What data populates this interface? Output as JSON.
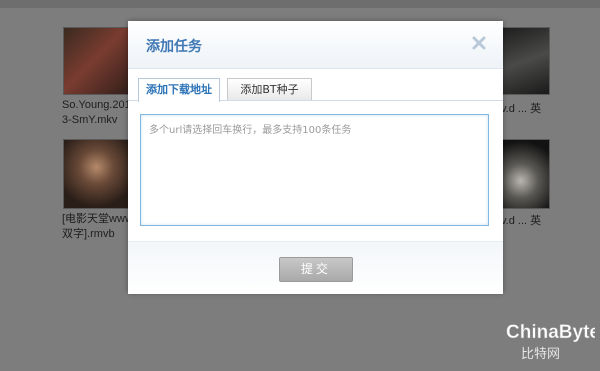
{
  "background_videos": [
    {
      "name_line1": "So.Young.201",
      "name_line2": "3-SmY.mkv"
    },
    {
      "name_line1": "[电影天堂www",
      "name_line2": "双字].rmvb"
    }
  ],
  "right_column_text": [
    "v.d ... 英",
    "v.d ... 英"
  ],
  "dialog": {
    "title": "添加任务",
    "tabs": [
      {
        "label": "添加下载地址",
        "active": true
      },
      {
        "label": "添加BT种子",
        "active": false
      }
    ],
    "textarea_placeholder": "多个url请选择回车换行，最多支持100条任务",
    "submit_label": "提交"
  },
  "watermark": {
    "brand": "ChinaByte",
    "subtitle": "比特网"
  },
  "colors": {
    "overlay": "#7d7d7d",
    "accent": "#3f78b4",
    "textarea_border": "#7fb7de",
    "button_disabled": "#b5b5b5"
  }
}
